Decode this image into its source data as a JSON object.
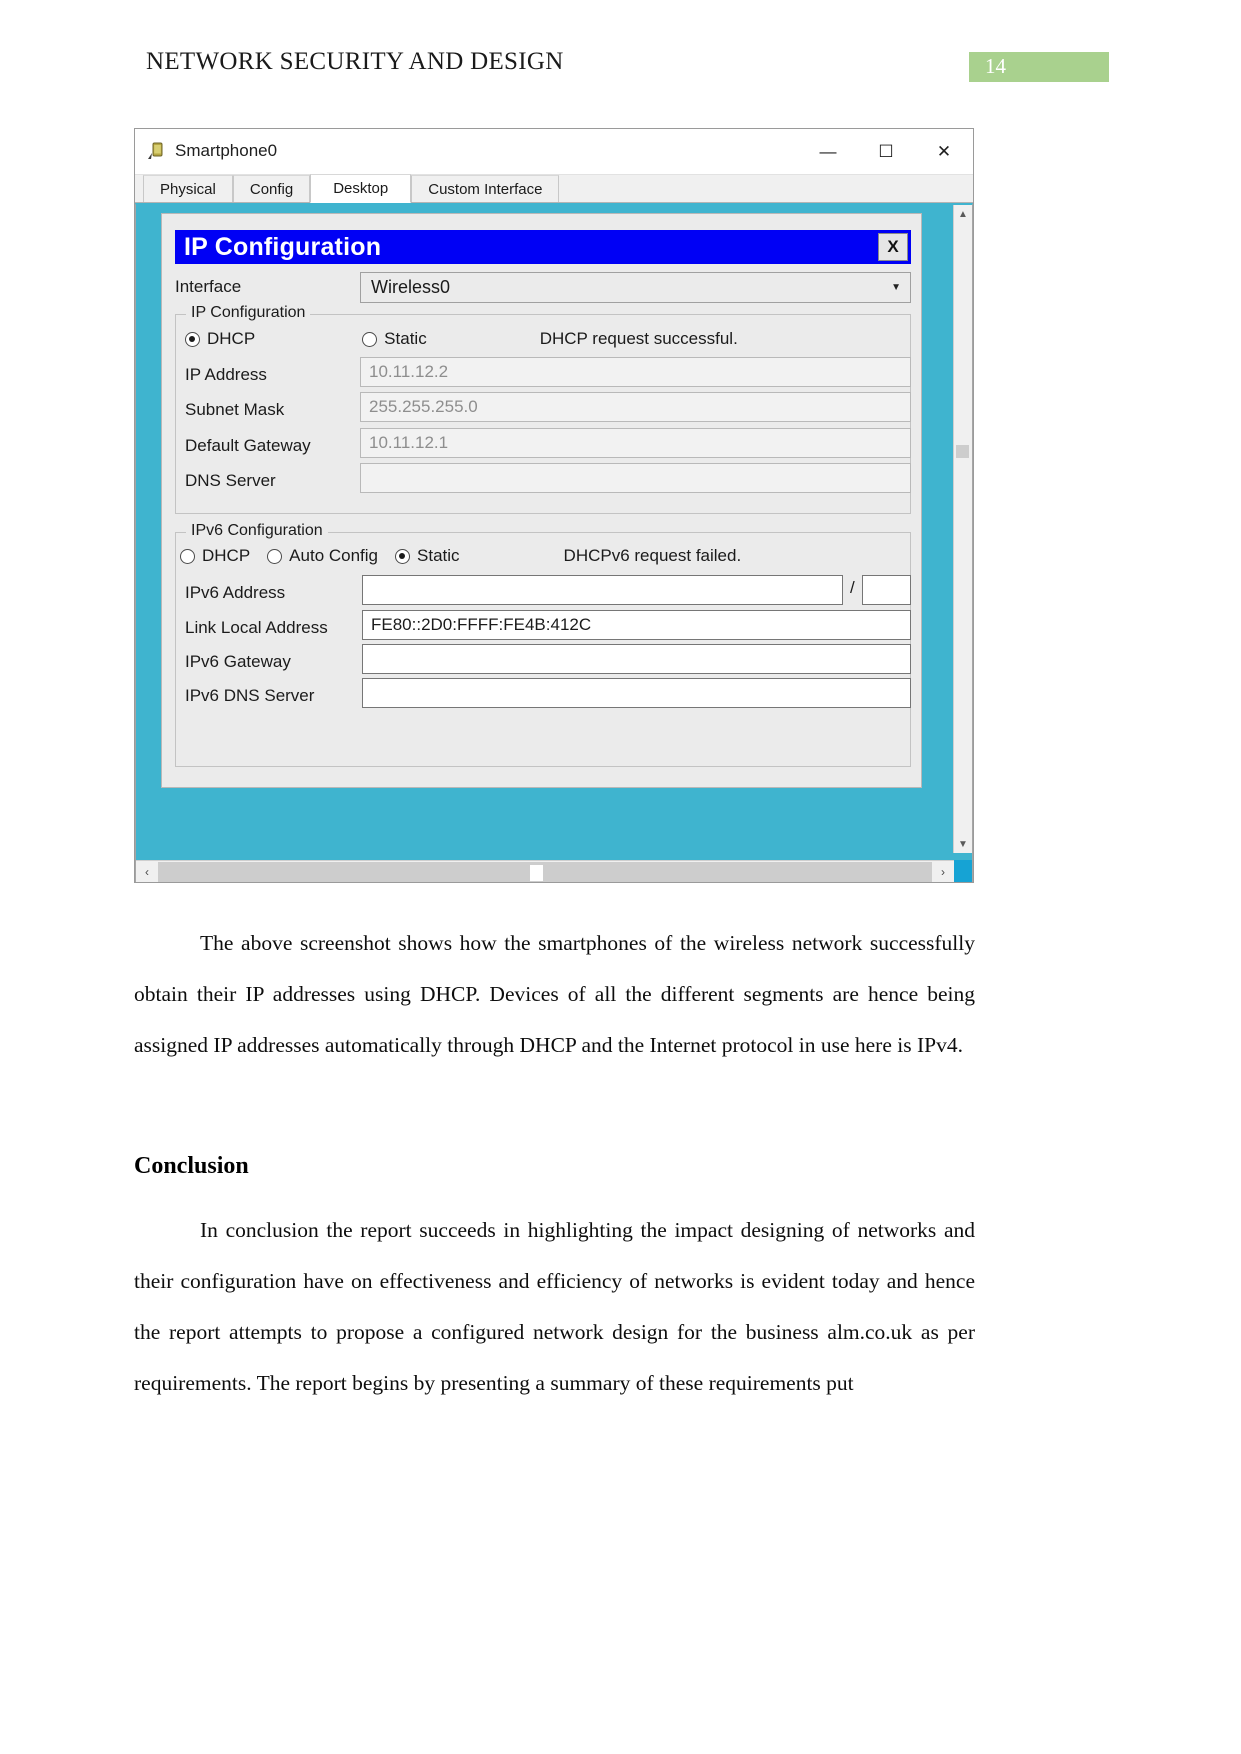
{
  "document": {
    "running_head": "NETWORK SECURITY AND DESIGN",
    "page_number": "14",
    "badge_color": "#a9d18e",
    "paragraph_1": "The above screenshot shows how the smartphones of the wireless network successfully obtain their IP addresses using DHCP. Devices of all the different segments are hence being assigned IP addresses automatically through DHCP and the Internet protocol in use here is IPv4.",
    "conclusion_heading": "Conclusion",
    "paragraph_2": "In conclusion the report succeeds in highlighting the impact designing of networks and their configuration have on effectiveness and efficiency of networks is evident today and hence the report attempts to propose a configured network design for the business alm.co.uk as per requirements. The report begins by presenting a summary of these requirements put"
  },
  "screenshot": {
    "window": {
      "title": "Smartphone0",
      "icon": "smartphone-icon",
      "minimize": "—",
      "maximize": "☐",
      "close": "✕"
    },
    "tabs": [
      {
        "label": "Physical",
        "active": false
      },
      {
        "label": "Config",
        "active": false
      },
      {
        "label": "Desktop",
        "active": true
      },
      {
        "label": "Custom Interface",
        "active": false
      }
    ],
    "desktop_background": "#3fb4cf",
    "dialog": {
      "title": "IP Configuration",
      "title_bar_color": "#0000f5",
      "close_label": "X",
      "interface_label": "Interface",
      "interface_value": "Wireless0",
      "ipv4": {
        "group_title": "IP Configuration",
        "dhcp_label": "DHCP",
        "static_label": "Static",
        "selected": "DHCP",
        "status": "DHCP request successful.",
        "fields": [
          {
            "label": "IP Address",
            "value": "10.11.12.2"
          },
          {
            "label": "Subnet Mask",
            "value": "255.255.255.0"
          },
          {
            "label": "Default Gateway",
            "value": "10.11.12.1"
          },
          {
            "label": "DNS Server",
            "value": ""
          }
        ]
      },
      "ipv6": {
        "group_title": "IPv6 Configuration",
        "dhcp_label": "DHCP",
        "auto_config_label": "Auto Config",
        "static_label": "Static",
        "selected": "Static",
        "status": "DHCPv6 request failed.",
        "prefix_separator": "/",
        "fields": [
          {
            "label": "IPv6 Address",
            "value": ""
          },
          {
            "label": "Link Local Address",
            "value": "FE80::2D0:FFFF:FE4B:412C"
          },
          {
            "label": "IPv6 Gateway",
            "value": ""
          },
          {
            "label": "IPv6 DNS Server",
            "value": ""
          }
        ]
      }
    },
    "scrollbars": {
      "up_arrow": "▲",
      "down_arrow": "▼",
      "left_arrow": "‹",
      "right_arrow": "›"
    }
  }
}
